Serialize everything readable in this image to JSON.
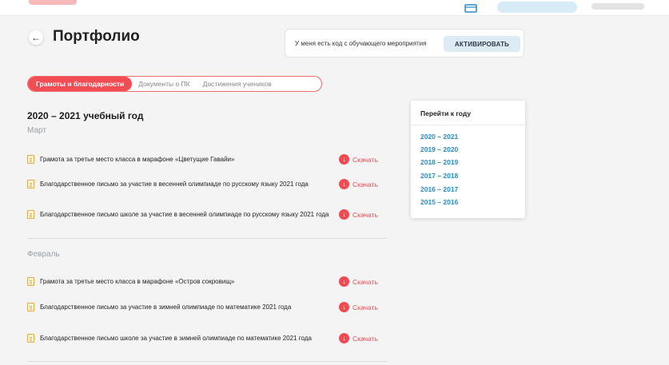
{
  "header": {
    "back_icon": "arrow-left-icon",
    "title": "Портфолио"
  },
  "code_box": {
    "label": "У меня есть код с обучающего мероприятия",
    "button_label": "АКТИВИРОВАТЬ"
  },
  "tabs": [
    {
      "label": "Грамоты и благодарности",
      "active": true
    },
    {
      "label": "Документы о ПК",
      "active": false
    },
    {
      "label": "Достижения учеников",
      "active": false
    }
  ],
  "section": {
    "year_title": "2020 – 2021 учебный год",
    "months": [
      {
        "name": "Март",
        "documents": [
          "Грамота за третье место класса в марафоне «Цветущие Гавайи»",
          "Благодарственное письмо за участие в весенней олимпиаде по русскому языку 2021 года",
          "Благодарственное письмо школе за участие в весенней олимпиаде по русскому языку 2021 года"
        ]
      },
      {
        "name": "Февраль",
        "documents": [
          "Грамота за третье место класса в марафоне «Остров сокровищ»",
          "Благодарственное письмо за участие в зимней олимпиаде по математике 2021 года",
          "Благодарственное письмо школе за участие в зимней олимпиаде по математике 2021 года"
        ]
      }
    ]
  },
  "download_label": "Скачать",
  "year_nav": {
    "title": "Перейти к году",
    "years": [
      "2020 – 2021",
      "2019 – 2020",
      "2018 – 2019",
      "2017 – 2018",
      "2016 – 2017",
      "2015 – 2016"
    ]
  },
  "colors": {
    "accent_red": "#f24d55",
    "link_blue": "#2a8cc9",
    "activate_bg": "#dcebf4"
  }
}
